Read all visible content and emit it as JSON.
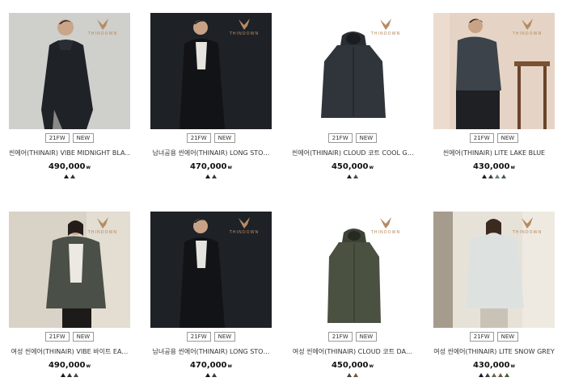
{
  "brand_logo_text": "THINDOWN",
  "products": [
    {
      "name": "씬에어(THINAIR) VIBE MIDNIGHT BLA…",
      "price": "490,000",
      "unit": "w",
      "badges": [
        "21FW",
        "NEW"
      ],
      "swatches": [
        "#1a1a1a",
        "#2f3a2c"
      ],
      "icon": "model-photo-man-black-parka"
    },
    {
      "name": "남녀공용 씬에어(THINAIR) LONG STO…",
      "price": "470,000",
      "unit": "w",
      "badges": [
        "21FW",
        "NEW"
      ],
      "swatches": [
        "#1a1a1a",
        "#3b3f33"
      ],
      "icon": "model-photo-man-long-black-coat"
    },
    {
      "name": "씬에어(THINAIR) CLOUD 코트 COOL G…",
      "price": "450,000",
      "unit": "w",
      "badges": [
        "21FW",
        "NEW"
      ],
      "swatches": [
        "#222",
        "#4a4a42"
      ],
      "icon": "product-photo-charcoal-parka"
    },
    {
      "name": "씬에어(THINAIR) LITE LAKE BLUE",
      "price": "430,000",
      "unit": "w",
      "badges": [
        "21FW",
        "NEW"
      ],
      "swatches": [
        "#1a1a1a",
        "#3f3f3f",
        "#6b7f7c",
        "#4d5a44"
      ],
      "icon": "model-photo-man-seated-blue-puffer"
    },
    {
      "name": "여성 씬에어(THINAIR) VIBE 바이트 EA…",
      "price": "490,000",
      "unit": "w",
      "badges": [
        "21FW",
        "NEW"
      ],
      "swatches": [
        "#1a1a1a",
        "#2f2f2f",
        "#4b4b45"
      ],
      "icon": "model-photo-woman-khaki-puffer"
    },
    {
      "name": "남녀공용 씬에어(THINAIR) LONG STO…",
      "price": "470,000",
      "unit": "w",
      "badges": [
        "21FW",
        "NEW"
      ],
      "swatches": [
        "#1a1a1a",
        "#3b3f33"
      ],
      "icon": "model-photo-man-long-black-coat"
    },
    {
      "name": "여성 씬에어(THINAIR) CLOUD 코트 DA…",
      "price": "450,000",
      "unit": "w",
      "badges": [
        "21FW",
        "NEW"
      ],
      "swatches": [
        "#3f4a38",
        "#6b5a3a"
      ],
      "icon": "product-photo-olive-long-parka"
    },
    {
      "name": "여성 씬에어(THINAIR) LITE SNOW GREY",
      "price": "430,000",
      "unit": "w",
      "badges": [
        "21FW",
        "NEW"
      ],
      "swatches": [
        "#1a1a1a",
        "#3c3c3c",
        "#5b6b55",
        "#6b5a3a",
        "#4a5a44"
      ],
      "icon": "model-photo-woman-snow-grey-puffer"
    }
  ]
}
